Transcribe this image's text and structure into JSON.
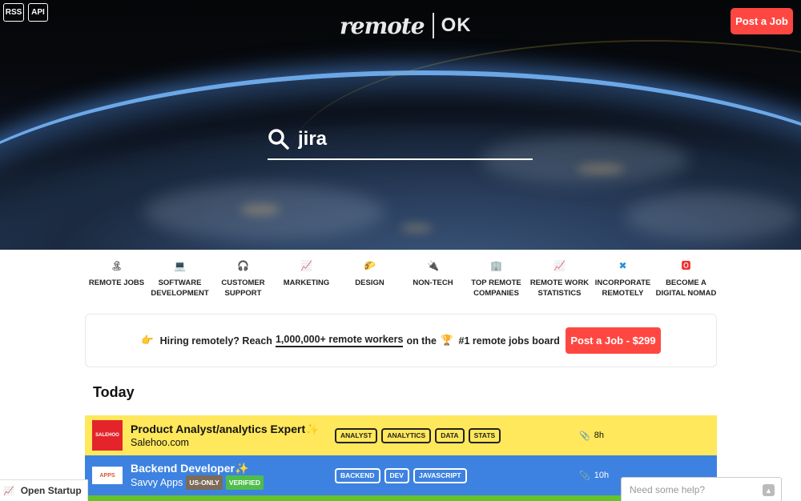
{
  "header": {
    "rss_label": "RSS",
    "api_label": "API",
    "logo_word": "remote",
    "logo_ok": "OK",
    "post_job_label": "Post a Job"
  },
  "search": {
    "value": "jira"
  },
  "categories": [
    {
      "icon": "🏝",
      "label": "REMOTE JOBS"
    },
    {
      "icon": "💻",
      "label": "SOFTWARE DEVELOPMENT"
    },
    {
      "icon": "🎧",
      "label": "CUSTOMER SUPPORT"
    },
    {
      "icon": "📈",
      "label": "MARKETING"
    },
    {
      "icon": "🌮",
      "label": "DESIGN"
    },
    {
      "icon": "🔌",
      "label": "NON-TECH"
    },
    {
      "icon": "🏢",
      "label": "TOP REMOTE COMPANIES"
    },
    {
      "icon": "📈",
      "label": "REMOTE WORK STATISTICS"
    },
    {
      "icon": "✖",
      "label": "INCORPORATE REMOTELY"
    },
    {
      "icon": "🅾",
      "label": "BECOME A DIGITAL NOMAD"
    }
  ],
  "banner": {
    "emoji": "👉",
    "text_before": "Hiring remotely? Reach",
    "highlight": "1,000,000+ remote workers",
    "text_mid": "on the",
    "trophy": "🏆",
    "text_after": "#1 remote jobs board",
    "button_label": "Post a Job - $299"
  },
  "section_title": "Today",
  "jobs": [
    {
      "title": "Product Analyst/analytics Expert",
      "sparkle": "✨",
      "company": "Salehoo.com",
      "logo_text": "SALEHOO",
      "tags": [
        "ANALYST",
        "ANALYTICS",
        "DATA",
        "STATS"
      ],
      "age": "8h",
      "bg_color": "#ffe85b"
    },
    {
      "title": "Backend Developer",
      "sparkle": "✨",
      "company": "Savvy Apps",
      "badge_us": "US-ONLY",
      "badge_verified": "VERIFIED",
      "logo_text": "APPS",
      "tags": [
        "BACKEND",
        "DEV",
        "JAVASCRIPT"
      ],
      "age": "10h",
      "bg_color": "#3d82e0"
    }
  ],
  "open_startup": {
    "icon": "📈",
    "label": "Open Startup"
  },
  "help_widget": {
    "placeholder": "Need some help?"
  },
  "colors": {
    "accent": "#ff4742",
    "verified": "#4fbd4b",
    "us_only": "#7d6b5a"
  }
}
